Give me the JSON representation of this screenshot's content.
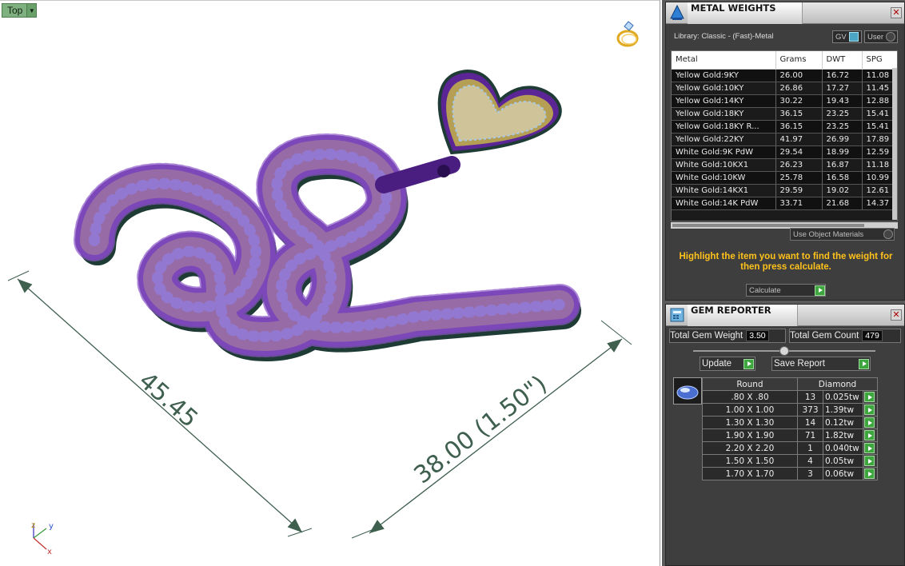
{
  "viewport": {
    "view_name": "Top",
    "axis_labels": {
      "z": "z",
      "y": "y",
      "x": "x"
    },
    "dimensions": {
      "length": "45.45",
      "width": "38.00 (1.50\")"
    },
    "colors": {
      "metal": "#6b2fa5",
      "gold": "#c9b46b",
      "stone": "#9fc3e6",
      "dimension": "#3f5f4f"
    }
  },
  "metal_weights": {
    "title": "METAL WEIGHTS",
    "library": "Library: Classic - (Fast)-Metal",
    "gv_label": "GV",
    "user_label": "User",
    "columns": [
      "Metal",
      "Grams",
      "DWT",
      "SPG"
    ],
    "rows": [
      [
        "Yellow Gold:9KY",
        "26.00",
        "16.72",
        "11.08"
      ],
      [
        "Yellow Gold:10KY",
        "26.86",
        "17.27",
        "11.45"
      ],
      [
        "Yellow Gold:14KY",
        "30.22",
        "19.43",
        "12.88"
      ],
      [
        "Yellow Gold:18KY",
        "36.15",
        "23.25",
        "15.41"
      ],
      [
        "Yellow Gold:18KY R...",
        "36.15",
        "23.25",
        "15.41"
      ],
      [
        "Yellow Gold:22KY",
        "41.97",
        "26.99",
        "17.89"
      ],
      [
        "White Gold:9K PdW",
        "29.54",
        "18.99",
        "12.59"
      ],
      [
        "White Gold:10KX1",
        "26.23",
        "16.87",
        "11.18"
      ],
      [
        "White Gold:10KW",
        "25.78",
        "16.58",
        "10.99"
      ],
      [
        "White Gold:14KX1",
        "29.59",
        "19.02",
        "12.61"
      ],
      [
        "White Gold:14K PdW",
        "33.71",
        "21.68",
        "14.37"
      ]
    ],
    "use_object_materials": "Use Object Materials",
    "instruction": "Highlight the item you want to find the weight for then press calculate.",
    "calculate_label": "Calculate"
  },
  "gem_reporter": {
    "title": "GEM REPORTER",
    "total_weight_label": "Total Gem Weight",
    "total_weight": "3.50",
    "total_count_label": "Total Gem Count",
    "total_count": "479",
    "update_label": "Update",
    "save_report_label": "Save Report",
    "shape_header": "Round",
    "type_header": "Diamond",
    "rows": [
      {
        "size": ".80 X .80",
        "count": "13",
        "ctw": "0.025tw"
      },
      {
        "size": "1.00 X 1.00",
        "count": "373",
        "ctw": "1.39tw"
      },
      {
        "size": "1.30 X 1.30",
        "count": "14",
        "ctw": "0.12tw"
      },
      {
        "size": "1.90 X 1.90",
        "count": "71",
        "ctw": "1.82tw"
      },
      {
        "size": "2.20 X 2.20",
        "count": "1",
        "ctw": "0.040tw"
      },
      {
        "size": "1.50 X 1.50",
        "count": "4",
        "ctw": "0.05tw"
      },
      {
        "size": "1.70 X 1.70",
        "count": "3",
        "ctw": "0.06tw"
      }
    ]
  }
}
